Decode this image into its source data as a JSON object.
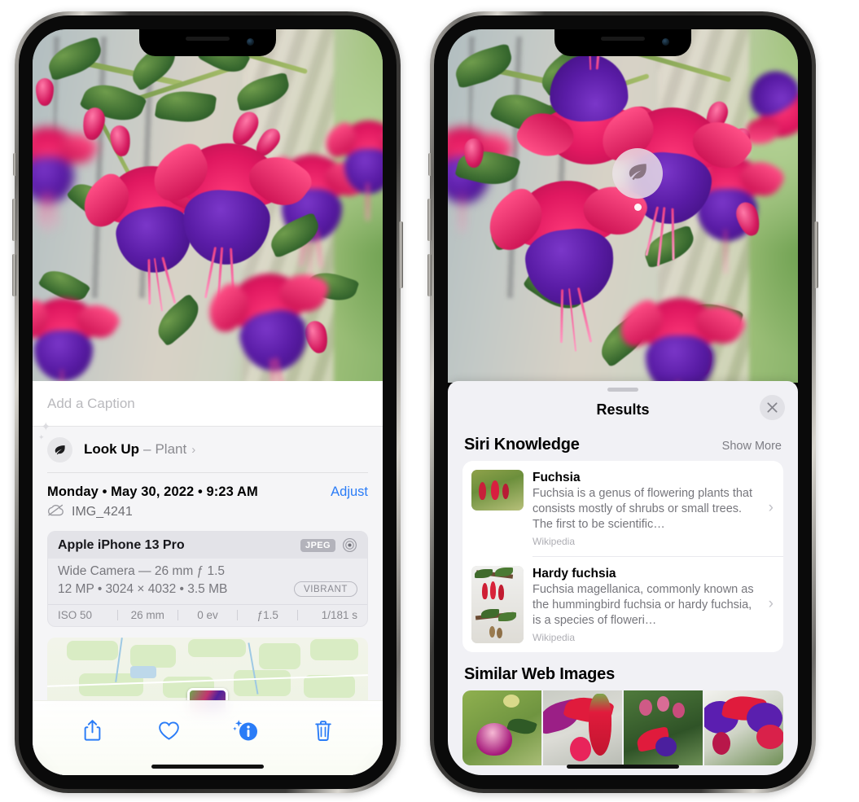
{
  "left_phone": {
    "photo": {
      "alt": "fuchsia-flowers-photo"
    },
    "caption_field": {
      "placeholder": "Add a Caption",
      "value": ""
    },
    "look_up": {
      "label": "Look Up",
      "dash": "–",
      "value": "Plant",
      "icon": "leaf-icon",
      "chevron": "›"
    },
    "date_row": {
      "date": "Monday • May 30, 2022 • 9:23 AM",
      "adjust_label": "Adjust"
    },
    "file_row": {
      "icon": "cloud-slash-icon",
      "filename": "IMG_4241"
    },
    "exif": {
      "device": "Apple iPhone 13 Pro",
      "format_badge": "JPEG",
      "raw_icon": "aperture-icon",
      "lens_line": "Wide Camera — 26 mm ƒ 1.5",
      "specs_line": "12 MP • 3024 × 4032 • 3.5 MB",
      "style_badge": "VIBRANT",
      "stats": [
        "ISO 50",
        "26 mm",
        "0 ev",
        "ƒ1.5",
        "1/181 s"
      ]
    },
    "map": {
      "name": "location-map-thumbnail"
    },
    "toolbar": {
      "items": [
        {
          "name": "share-button",
          "icon": "share-icon"
        },
        {
          "name": "favorite-button",
          "icon": "heart-icon"
        },
        {
          "name": "info-button",
          "icon": "info-sparkle-icon"
        },
        {
          "name": "delete-button",
          "icon": "trash-icon"
        }
      ],
      "accent_color": "#2a7cf7"
    }
  },
  "right_phone": {
    "photo_badge": {
      "icon": "leaf-icon",
      "name": "visual-lookup-badge"
    },
    "sheet": {
      "title": "Results",
      "close_icon": "close-icon"
    },
    "siri_knowledge": {
      "title": "Siri Knowledge",
      "show_more": "Show More",
      "results": [
        {
          "title": "Fuchsia",
          "description": "Fuchsia is a genus of flowering plants that consists mostly of shrubs or small trees. The first to be scientific…",
          "source": "Wikipedia",
          "chevron": "›"
        },
        {
          "title": "Hardy fuchsia",
          "description": "Fuchsia magellanica, commonly known as the hummingbird fuchsia or hardy fuchsia, is a species of floweri…",
          "source": "Wikipedia",
          "chevron": "›"
        }
      ]
    },
    "similar_web_images": {
      "title": "Similar Web Images",
      "count": 4
    }
  }
}
